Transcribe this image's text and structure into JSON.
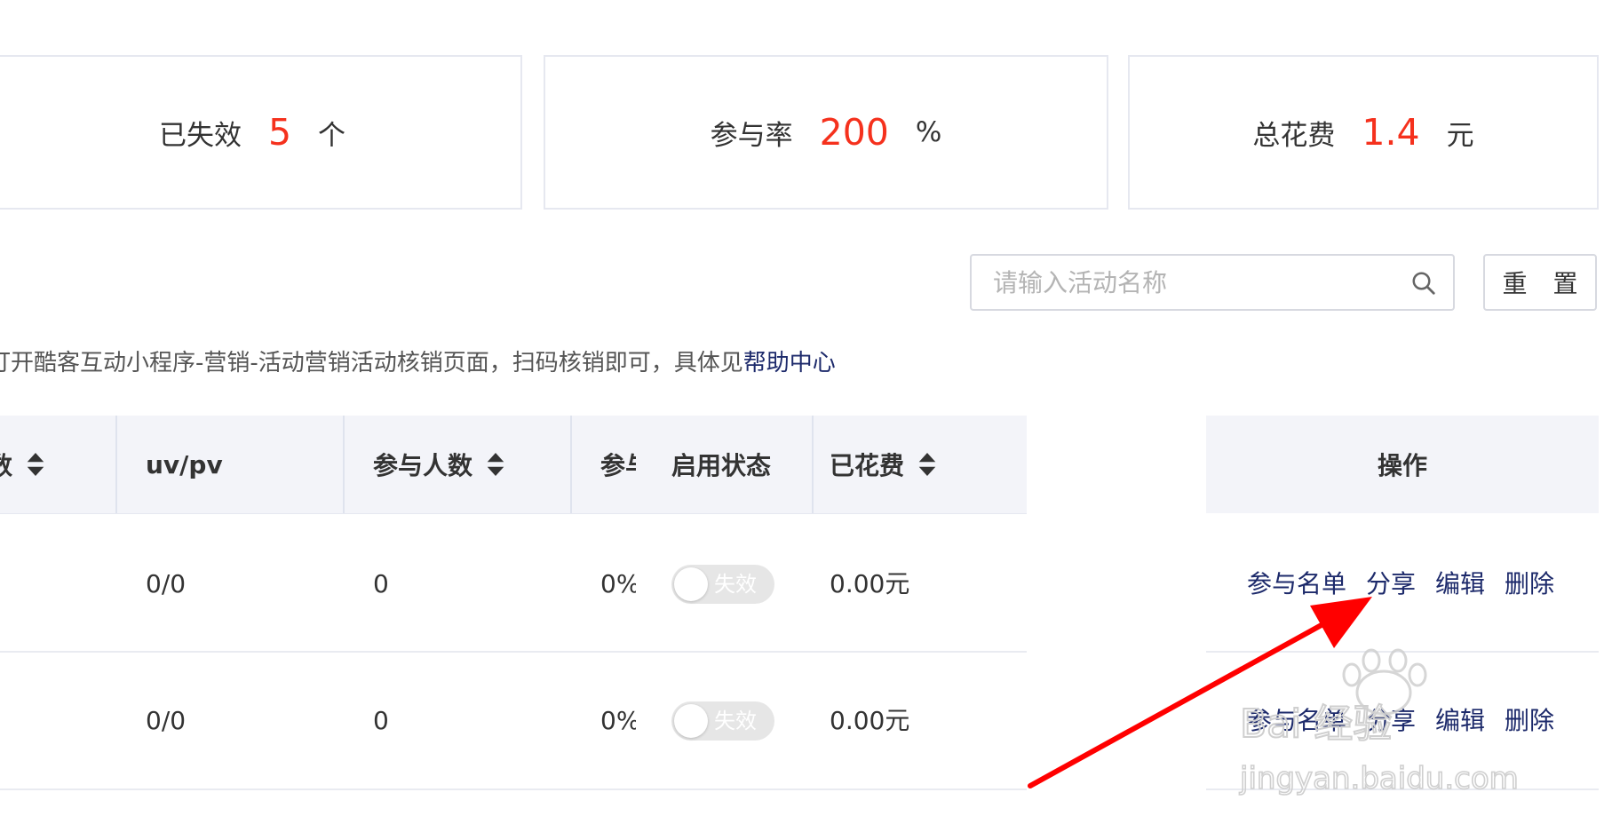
{
  "stats": [
    {
      "label": "已失效",
      "value": "5",
      "unit": "个"
    },
    {
      "label": "参与率",
      "value": "200",
      "unit": "%"
    },
    {
      "label": "总花费",
      "value": "1.4",
      "unit": "元"
    }
  ],
  "search": {
    "placeholder": "请输入活动名称",
    "reset_label": "重 置"
  },
  "notice": {
    "text": "打开酷客互动小程序-营销-活动营销活动核销页面，扫码核销即可，具体见",
    "link": "帮助中心"
  },
  "table": {
    "headers": [
      "数",
      "uv/pv",
      "参与人数",
      "参与率",
      "启用状态",
      "已花费",
      "操作"
    ],
    "rows": [
      {
        "uvpv": "0/0",
        "participants": "0",
        "rate": "0%",
        "status": "失效",
        "cost": "0.00元"
      },
      {
        "uvpv": "0/0",
        "participants": "0",
        "rate": "0%",
        "status": "失效",
        "cost": "0.00元"
      }
    ],
    "actions": [
      "参与名单",
      "分享",
      "编辑",
      "删除"
    ]
  },
  "watermark": {
    "text": "Bai 经验",
    "url": "jingyan.baidu.com"
  },
  "colors": {
    "accent_red": "#f5311d",
    "link_navy": "#1d2a6b",
    "header_bg": "#f3f4f9",
    "arrow_red": "#ff0000"
  },
  "icons": {
    "search": "search-icon",
    "sort": "sort-icon",
    "arrow": "annotation-arrow"
  }
}
